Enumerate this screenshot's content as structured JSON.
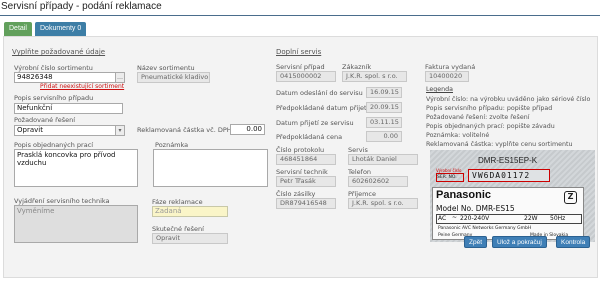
{
  "title": "Servisní případy - podání reklamace",
  "tabs": [
    {
      "label": "Detail"
    },
    {
      "label": "Dokumenty 0"
    }
  ],
  "left": {
    "section_title": "Vyplňte požadované údaje",
    "serial_label": "Výrobní číslo sortimentu",
    "serial_value": "94826348",
    "nonexistent_link": "Přidat neexistující sortiment",
    "issue_label": "Popis servisního případu",
    "issue_value": "Nefunkční",
    "solution_label": "Požadované řešení",
    "solution_value": "Opravit",
    "work_label": "Popis objednaných prací",
    "work_value": "Prasklá koncovka pro přívod vzduchu",
    "tech_label": "Vyjádření servisního technika",
    "tech_placeholder": "Vyměníme"
  },
  "middle": {
    "product_name_label": "Název sortimentu",
    "product_name_value": "Pneumatické kladivo",
    "claim_amount_label": "Reklamovaná částka vč. DPH",
    "claim_amount_value": "0.00",
    "note_label": "Poznámka",
    "phase_label": "Fáze reklamace",
    "phase_value": "Zadaná",
    "actual_solution_label": "Skutečné řešení",
    "actual_solution_value": "Opravit"
  },
  "service": {
    "section_title": "Doplní servis",
    "case_label": "Servisní případ",
    "case_value": "0415000002",
    "customer_label": "Zákazník",
    "customer_value": "J.K.R. spol. s r.o.",
    "invoice_label": "Faktura vydaná",
    "invoice_value": "10400020",
    "sent_label": "Datum odeslání do servisu",
    "sent_value": "16.09.15",
    "expected_label": "Předpokládané datum přijetí",
    "expected_value": "20.09.15",
    "received_label": "Datum přijetí ze servisu",
    "received_value": "03.11.15",
    "expected_price_label": "Předpokládaná cena",
    "expected_price_value": "0.00",
    "protocol_label": "Číslo protokolu",
    "protocol_value": "468451864",
    "serviceman_label": "Servis",
    "serviceman_value": "Lhoták Daniel",
    "technician_label": "Servisní technik",
    "technician_value": "Petr Třasák",
    "phone_label": "Telefon",
    "phone_value": "602602602",
    "parcel_label": "Číslo zásilky",
    "parcel_value": "DR879416548",
    "recipient_label": "Příjemce",
    "recipient_value": "J.K.R. spol. s r.o."
  },
  "legend": {
    "title": "Legenda",
    "lines": [
      "Výrobní číslo: na výrobku uváděno jako sériové číslo",
      "Popis servisního případu: popište případ",
      "Požadované řešení: zvolte řešení",
      "Popis objednaných prací: popište závadu",
      "Poznámka: volitelné",
      "Reklamovaná částka: vyplňte cenu sortimentu"
    ]
  },
  "label_photo": {
    "model_top": "DMR-ES15EP-K",
    "serial_tag": "Výrobní číslo",
    "ser_no": "SER. NO.",
    "serial_code": "VW6DA01172",
    "brand": "Panasonic",
    "model_line": "Model No. DMR-ES15",
    "power_ac": "AC",
    "power_spec": "220-240V",
    "power_w": "22W",
    "power_hz": "50Hz",
    "maker": "Panasonic AVC Networks Germany GmbH",
    "city": "Peine Germany",
    "origin": "Made in Slovakia"
  },
  "buttons": {
    "back": "Zpět",
    "save": "Ulož a pokračuj",
    "check": "Kontrola"
  }
}
